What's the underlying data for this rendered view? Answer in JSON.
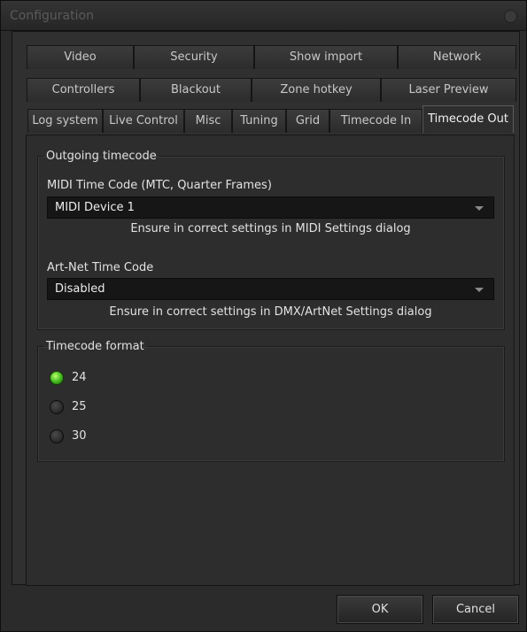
{
  "window": {
    "title": "Configuration"
  },
  "tabs": {
    "row1": [
      "Video",
      "Security",
      "Show import",
      "Network"
    ],
    "row2": [
      "Controllers",
      "Blackout",
      "Zone hotkey",
      "Laser Preview"
    ],
    "row3": [
      "Log system",
      "Live Control",
      "Misc",
      "Tuning",
      "Grid",
      "Timecode In",
      "Timecode Out"
    ],
    "active": "Timecode Out"
  },
  "outgoing": {
    "legend": "Outgoing timecode",
    "mtc_label": "MIDI Time Code (MTC, Quarter Frames)",
    "mtc_value": "MIDI Device 1",
    "mtc_hint": "Ensure in correct settings in MIDI Settings dialog",
    "artnet_label": "Art-Net Time Code",
    "artnet_value": "Disabled",
    "artnet_hint": "Ensure in correct settings in DMX/ArtNet Settings dialog"
  },
  "format": {
    "legend": "Timecode format",
    "options": [
      "24",
      "25",
      "30"
    ],
    "selected": "24"
  },
  "buttons": {
    "ok": "OK",
    "cancel": "Cancel"
  }
}
